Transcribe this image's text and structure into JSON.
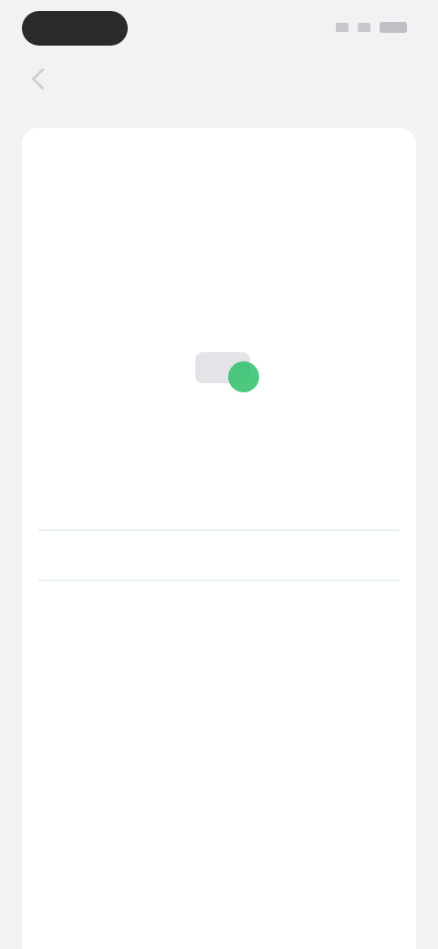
{
  "status_bar": {
    "time": ""
  },
  "nav": {
    "title": ""
  },
  "intro": {
    "title": "",
    "text": ""
  },
  "status_section": {
    "label": ""
  },
  "progress_section": {
    "label": "",
    "caption": ""
  },
  "settings": [
    {
      "title": "",
      "action": "",
      "description": ""
    },
    {
      "title": "",
      "action": "",
      "description": ""
    },
    {
      "title": "",
      "action": "",
      "description": ""
    },
    {
      "title": "",
      "action": "",
      "description": ""
    }
  ],
  "colors": {
    "accent": "#2fbf6a",
    "link": "#3b82f6",
    "background": "#f2f2f4",
    "card": "#ffffff"
  },
  "icons": {
    "back": "chevron-left-icon",
    "status": "status-indicator-icon"
  }
}
